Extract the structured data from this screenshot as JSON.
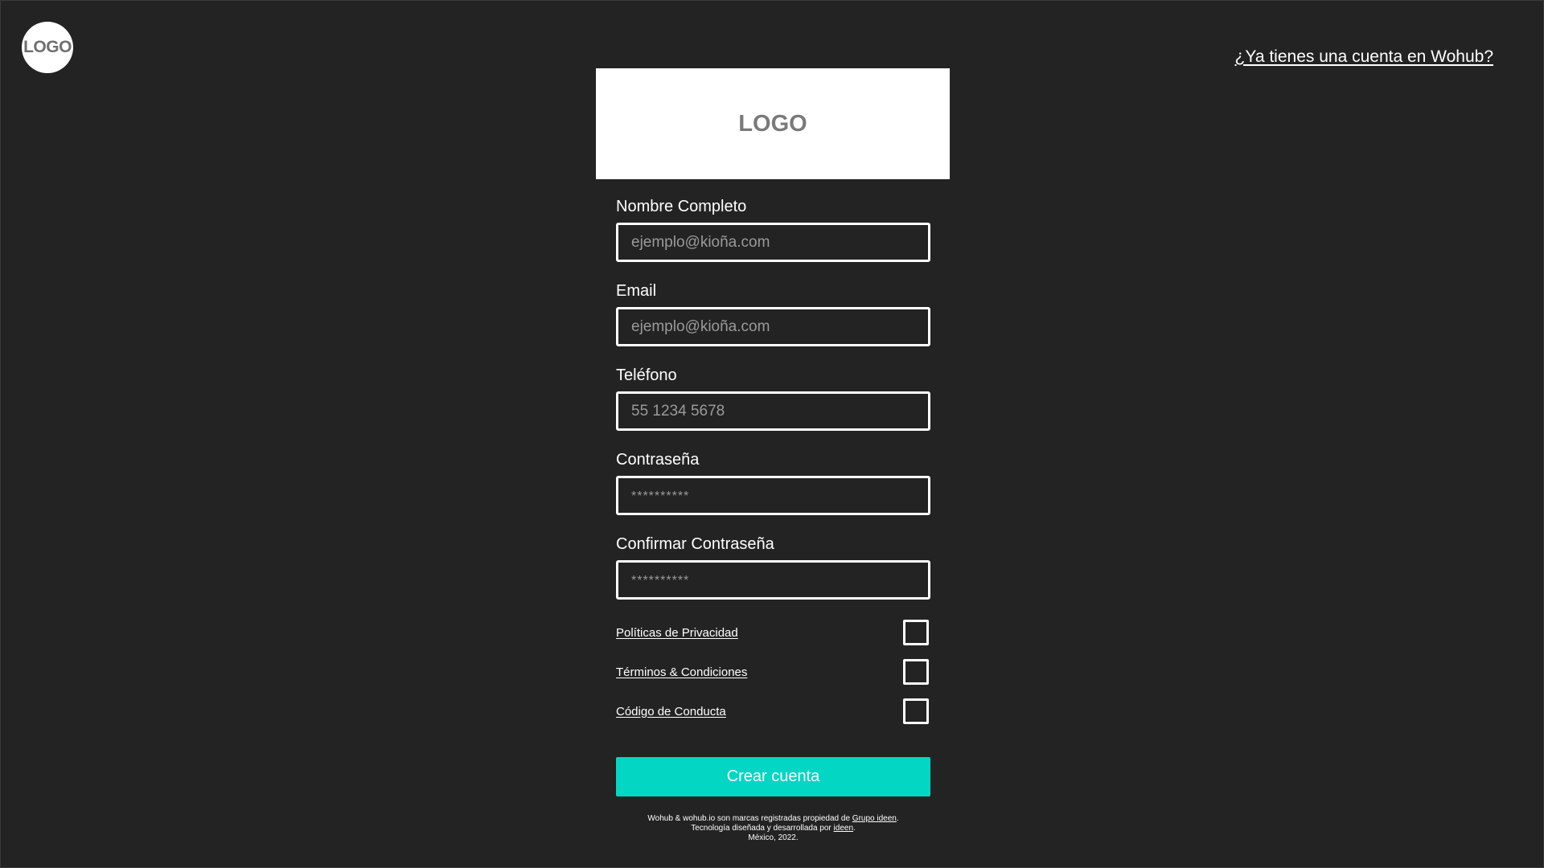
{
  "header": {
    "corner_logo": "LOGO",
    "login_link": "¿Ya tienes una cuenta en Wohub?"
  },
  "brand": {
    "logo_text": "LOGO"
  },
  "form": {
    "full_name": {
      "label": "Nombre Completo",
      "placeholder": "ejemplo@kioña.com"
    },
    "email": {
      "label": "Email",
      "placeholder": "ejemplo@kioña.com"
    },
    "phone": {
      "label": "Teléfono",
      "placeholder": "55 1234 5678"
    },
    "password": {
      "label": "Contraseña",
      "placeholder": "**********"
    },
    "confirm_password": {
      "label": "Confirmar Contraseña",
      "placeholder": "**********"
    },
    "checks": [
      {
        "label": "Políticas de Privacidad",
        "checked": false
      },
      {
        "label": "Términos & Condiciones",
        "checked": false
      },
      {
        "label": "Código de Conducta",
        "checked": false
      }
    ],
    "submit_label": "Crear cuenta"
  },
  "footer": {
    "line1_text": "Wohub & wohub.io son marcas registradas propiedad de ",
    "line1_link": "Grupo ideen",
    "line1_end": ".",
    "line2_text": "Tecnología diseñada y desarrollada por ",
    "line2_link": "ideen",
    "line2_end": ".",
    "line3": "México, 2022."
  },
  "colors": {
    "background": "#232323",
    "accent": "#04d6c4",
    "logo_text": "#7a7a7a"
  }
}
